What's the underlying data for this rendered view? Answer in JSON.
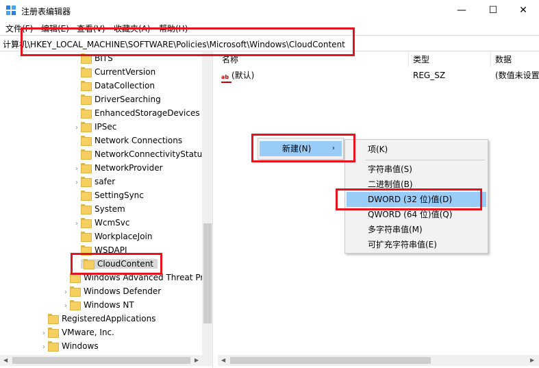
{
  "window": {
    "title": "注册表编辑器",
    "minimize": "—",
    "maximize": "☐",
    "close": "✕"
  },
  "menu": [
    "文件(F)",
    "编辑(E)",
    "查看(V)",
    "收藏夹(A)",
    "帮助(H)"
  ],
  "address": "计算机\\HKEY_LOCAL_MACHINE\\SOFTWARE\\Policies\\Microsoft\\Windows\\CloudContent",
  "tree": [
    {
      "label": "BITS"
    },
    {
      "label": "CurrentVersion"
    },
    {
      "label": "DataCollection"
    },
    {
      "label": "DriverSearching"
    },
    {
      "label": "EnhancedStorageDevices"
    },
    {
      "label": "IPSec"
    },
    {
      "label": "Network Connections"
    },
    {
      "label": "NetworkConnectivityStatus"
    },
    {
      "label": "NetworkProvider"
    },
    {
      "label": "safer"
    },
    {
      "label": "SettingSync"
    },
    {
      "label": "System"
    },
    {
      "label": "WcmSvc"
    },
    {
      "label": "WorkplaceJoin"
    },
    {
      "label": "WSDAPI"
    },
    {
      "label": "CloudContent"
    },
    {
      "label": "Windows Advanced Threat Pr"
    },
    {
      "label": "Windows Defender"
    },
    {
      "label": "Windows NT"
    },
    {
      "label": "RegisteredApplications"
    },
    {
      "label": "VMware, Inc."
    },
    {
      "label": "Windows"
    }
  ],
  "columns": {
    "name": "名称",
    "type": "类型",
    "data": "数据"
  },
  "values": [
    {
      "icon": "ab",
      "name": "(默认)",
      "type": "REG_SZ",
      "data": "(数值未设置"
    }
  ],
  "context_menu": {
    "new_label": "新建(N)",
    "arrow": "›",
    "submenu": [
      "项(K)",
      "字符串值(S)",
      "二进制值(B)",
      "DWORD (32 位)值(D)",
      "QWORD (64 位)值(Q)",
      "多字符串值(M)",
      "可扩充字符串值(E)"
    ]
  },
  "colors": {
    "highlight": "#99ccf7",
    "annotation": "#e8121f",
    "folder": "#f5cf5f"
  }
}
